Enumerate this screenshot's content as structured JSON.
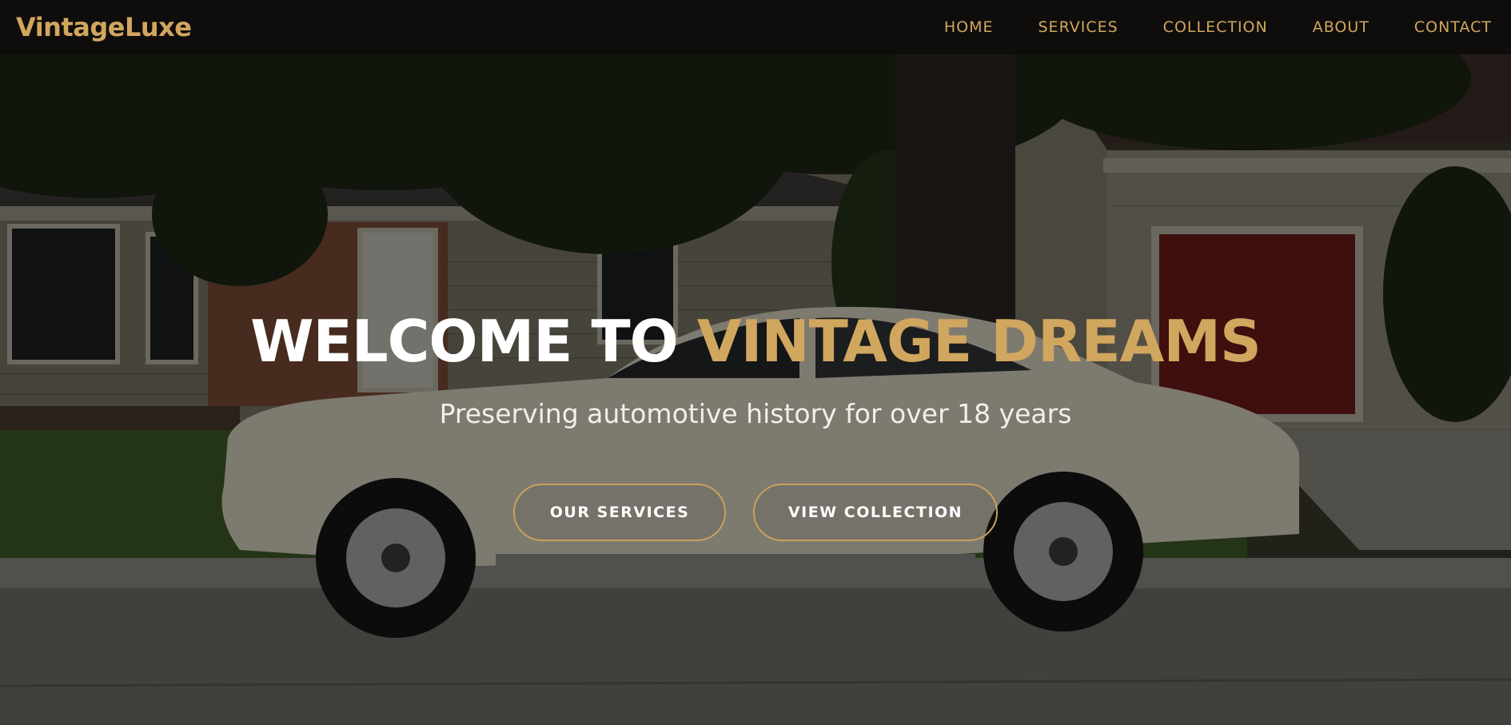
{
  "brand": {
    "name": "VintageLuxe",
    "accent_color": "#d1a65f"
  },
  "nav": {
    "items": [
      {
        "label": "HOME"
      },
      {
        "label": "SERVICES"
      },
      {
        "label": "COLLECTION"
      },
      {
        "label": "ABOUT"
      },
      {
        "label": "CONTACT"
      }
    ],
    "link_color": "#d1a65f",
    "background": "#0e0d0b"
  },
  "hero": {
    "title_white": "WELCOME TO",
    "title_accent": "VINTAGE DREAMS",
    "subtitle": "Preserving automotive history for over 18 years",
    "buttons": {
      "services": "OUR SERVICES",
      "collection": "VIEW COLLECTION"
    },
    "button_border_color": "#c9a05a"
  }
}
